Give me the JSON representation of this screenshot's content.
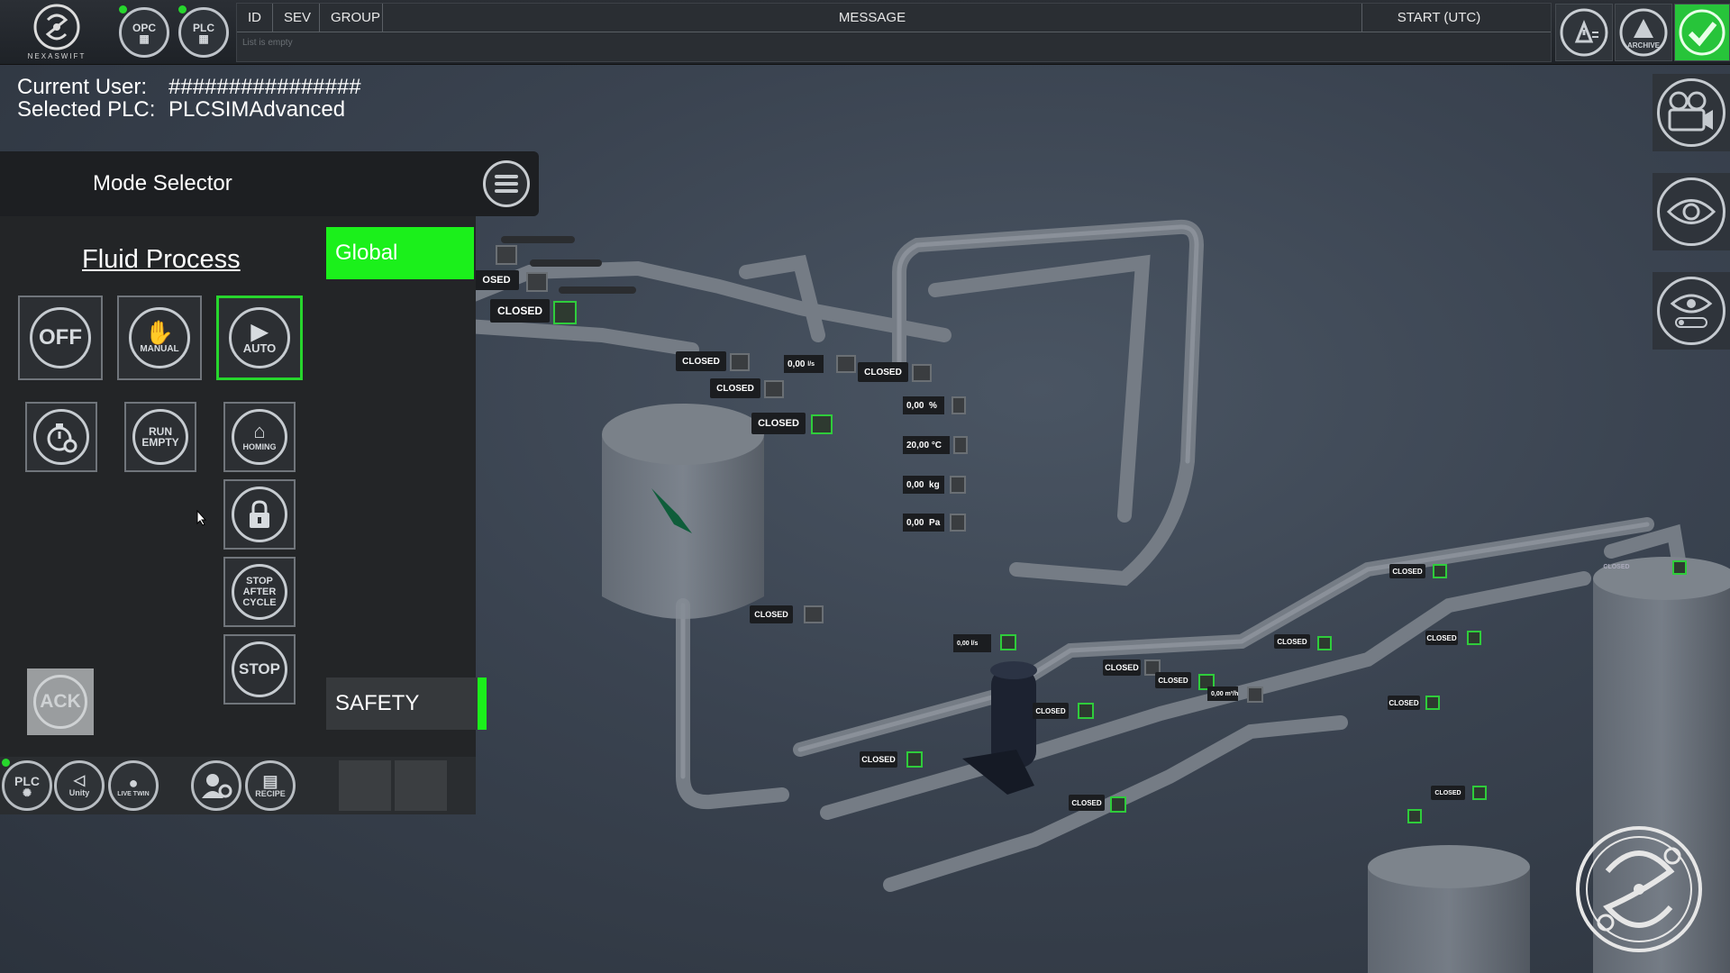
{
  "topbar": {
    "brand": "NEXASWIFT",
    "opc_label": "OPC",
    "plc_label": "PLC",
    "alarm_columns": [
      "ID",
      "SEV",
      "GROUP",
      "MESSAGE",
      "START (UTC)"
    ],
    "alarm_empty_text": "List is empty",
    "archive_label": "ARCHIVE"
  },
  "user_info": {
    "current_user_key": "Current User:",
    "current_user_value": "################",
    "selected_plc_key": "Selected PLC:",
    "selected_plc_value": "PLCSIMAdvanced"
  },
  "mode_selector": {
    "title": "Mode Selector",
    "process_title": "Fluid Process",
    "global_label": "Global",
    "safety_label": "SAFETY",
    "buttons": {
      "off": "OFF",
      "manual": "MANUAL",
      "auto": "AUTO",
      "run_empty_1": "RUN",
      "run_empty_2": "EMPTY",
      "homing": "HOMING",
      "stop_after_1": "STOP",
      "stop_after_2": "AFTER",
      "stop_after_3": "CYCLE",
      "stop": "STOP",
      "ack": "ACK"
    },
    "active_mode": "auto"
  },
  "bottom_bar": {
    "plc": "PLC",
    "unity": "Unity",
    "live_twin": "LIVE TWIN",
    "recipe": "RECIPE"
  },
  "scene": {
    "valve_tags": [
      "OSED",
      "CLOSED",
      "CLOSED",
      "CLOSED",
      "CLOSED",
      "CLOSED",
      "CLOSED",
      "CLOSED",
      "CLOSED",
      "CLOSED",
      "CLOSED",
      "CLOSED",
      "CLOSED",
      "CLOSED",
      "CLOSED",
      "CLOSED",
      "CLOSED",
      "CLOSED"
    ],
    "tank_meas": [
      {
        "value": "0,00",
        "unit": "%"
      },
      {
        "value": "20,00",
        "unit": "°C"
      },
      {
        "value": "0,00",
        "unit": "kg"
      },
      {
        "value": "0,00",
        "unit": "Pa"
      }
    ],
    "flow_meas_1": {
      "value": "0,00",
      "unit": "l/s"
    },
    "flow_meas_2": {
      "value": "0,00",
      "unit": "l/s"
    },
    "flow_meas_3": {
      "value": "0,00",
      "unit": "m³/h"
    }
  },
  "colors": {
    "accent_green": "#1bf01b",
    "status_green": "#27d62d",
    "panel_bg": "#232527"
  }
}
